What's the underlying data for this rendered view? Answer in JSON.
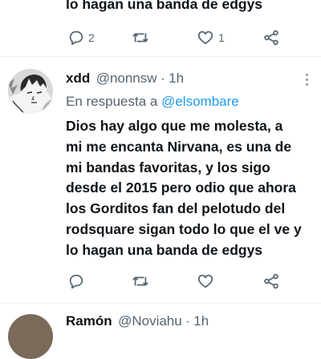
{
  "top_tweet": {
    "text_tail": "lo hagan una banda de edgys",
    "reply_count": "2",
    "like_count": "1"
  },
  "main_tweet": {
    "name": "xdd",
    "handle": "@nonnsw",
    "separator": "·",
    "time": "1h",
    "reply_prefix": "En respuesta a",
    "reply_target": "@elsombare",
    "text": "Dios hay algo que me molesta, a\nmi me encanta Nirvana, es una de\nmi bandas favoritas, y los sigo\ndesde el 2015 pero odio que ahora\nlos Gorditos fan del pelotudo del\nrodsquare sigan todo lo que el ve y\nlo hagan una banda de edgys"
  },
  "next_tweet": {
    "name": "Ramón",
    "handle": "@Noviahu",
    "separator": "·",
    "time": "1h"
  },
  "icons": [
    "reply-icon",
    "retweet-icon",
    "like-icon",
    "share-icon",
    "more-icon",
    "avatar"
  ]
}
